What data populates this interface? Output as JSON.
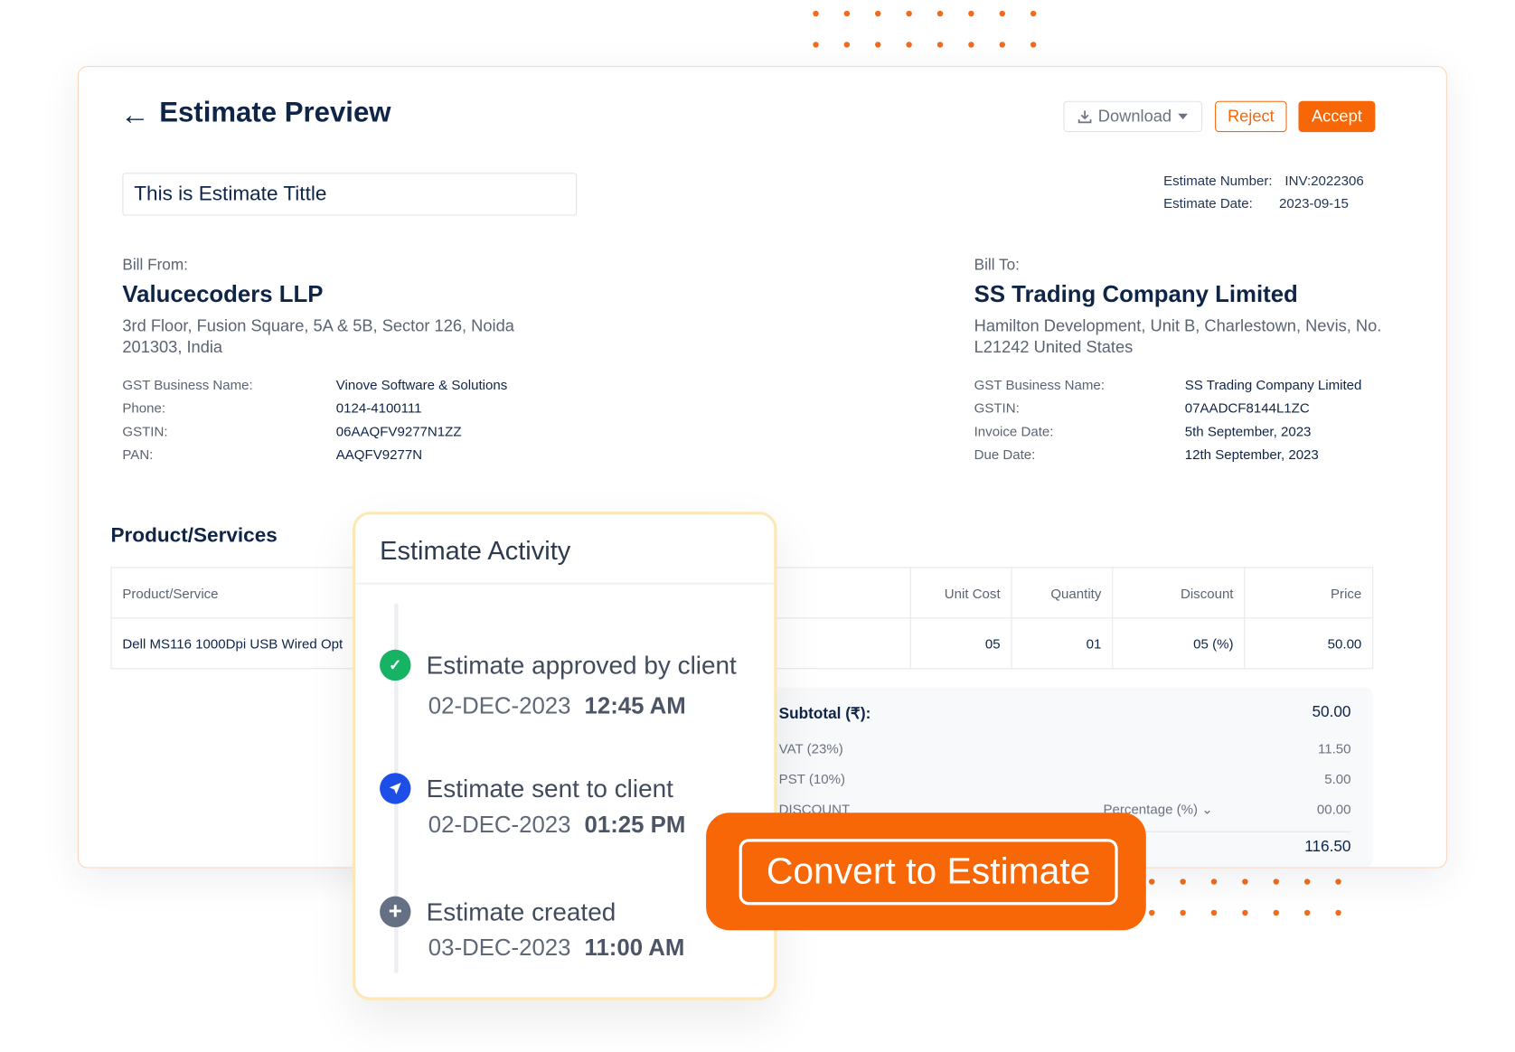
{
  "colors": {
    "accent": "#f76707",
    "navy": "#0f2548",
    "success": "#16b364",
    "info": "#1d4ee8",
    "muted": "#6b7280"
  },
  "header": {
    "title": "Estimate Preview",
    "download": "Download",
    "reject": "Reject",
    "accept": "Accept"
  },
  "estimate": {
    "title_value": "This is Estimate Tittle",
    "number_label": "Estimate Number:",
    "number": "INV:2022306",
    "date_label": "Estimate Date:",
    "date": "2023-09-15"
  },
  "bill_from": {
    "label": "Bill From:",
    "name": "Valucecoders LLP",
    "address": "3rd Floor, Fusion Square, 5A & 5B, Sector 126, Noida 201303, India",
    "details": [
      {
        "k": "GST Business Name:",
        "v": "Vinove Software & Solutions"
      },
      {
        "k": "Phone:",
        "v": "0124-4100111"
      },
      {
        "k": "GSTIN:",
        "v": "06AAQFV9277N1ZZ"
      },
      {
        "k": "PAN:",
        "v": "AAQFV9277N"
      }
    ]
  },
  "bill_to": {
    "label": "Bill To:",
    "name": "SS Trading Company Limited",
    "address": "Hamilton Development, Unit B, Charlestown, Nevis, No. L21242 United States",
    "details": [
      {
        "k": "GST Business Name:",
        "v": "SS Trading Company Limited"
      },
      {
        "k": "GSTIN:",
        "v": "07AADCF8144L1ZC"
      },
      {
        "k": "Invoice Date:",
        "v": "5th September, 2023"
      },
      {
        "k": "Due Date:",
        "v": "12th September, 2023"
      }
    ]
  },
  "products": {
    "heading": "Product/Services",
    "columns": [
      "Product/Service",
      "Unit Cost",
      "Quantity",
      "Discount",
      "Price"
    ],
    "rows": [
      [
        "Dell MS116 1000Dpi USB Wired Opt",
        "05",
        "01",
        "05 (%)",
        "50.00"
      ]
    ]
  },
  "totals": {
    "subtotal_label": "Subtotal (₹):",
    "subtotal": "50.00",
    "vat_label": "VAT (23%)",
    "vat": "11.50",
    "pst_label": "PST (10%)",
    "pst": "5.00",
    "discount_label": "DISCOUNT",
    "discount_type": "Percentage (%)",
    "discount": "00.00",
    "total": "116.50"
  },
  "activity": {
    "title": "Estimate Activity",
    "items": [
      {
        "icon": "check-circle-icon",
        "text": "Estimate approved by client",
        "date": "02-DEC-2023",
        "time": "12:45 AM"
      },
      {
        "icon": "send-icon",
        "text": "Estimate sent to client",
        "date": "02-DEC-2023",
        "time": "01:25 PM"
      },
      {
        "icon": "plus-circle-icon",
        "text": "Estimate created",
        "date": "03-DEC-2023",
        "time": "11:00 AM"
      }
    ]
  },
  "cta": {
    "label": "Convert to Estimate"
  }
}
